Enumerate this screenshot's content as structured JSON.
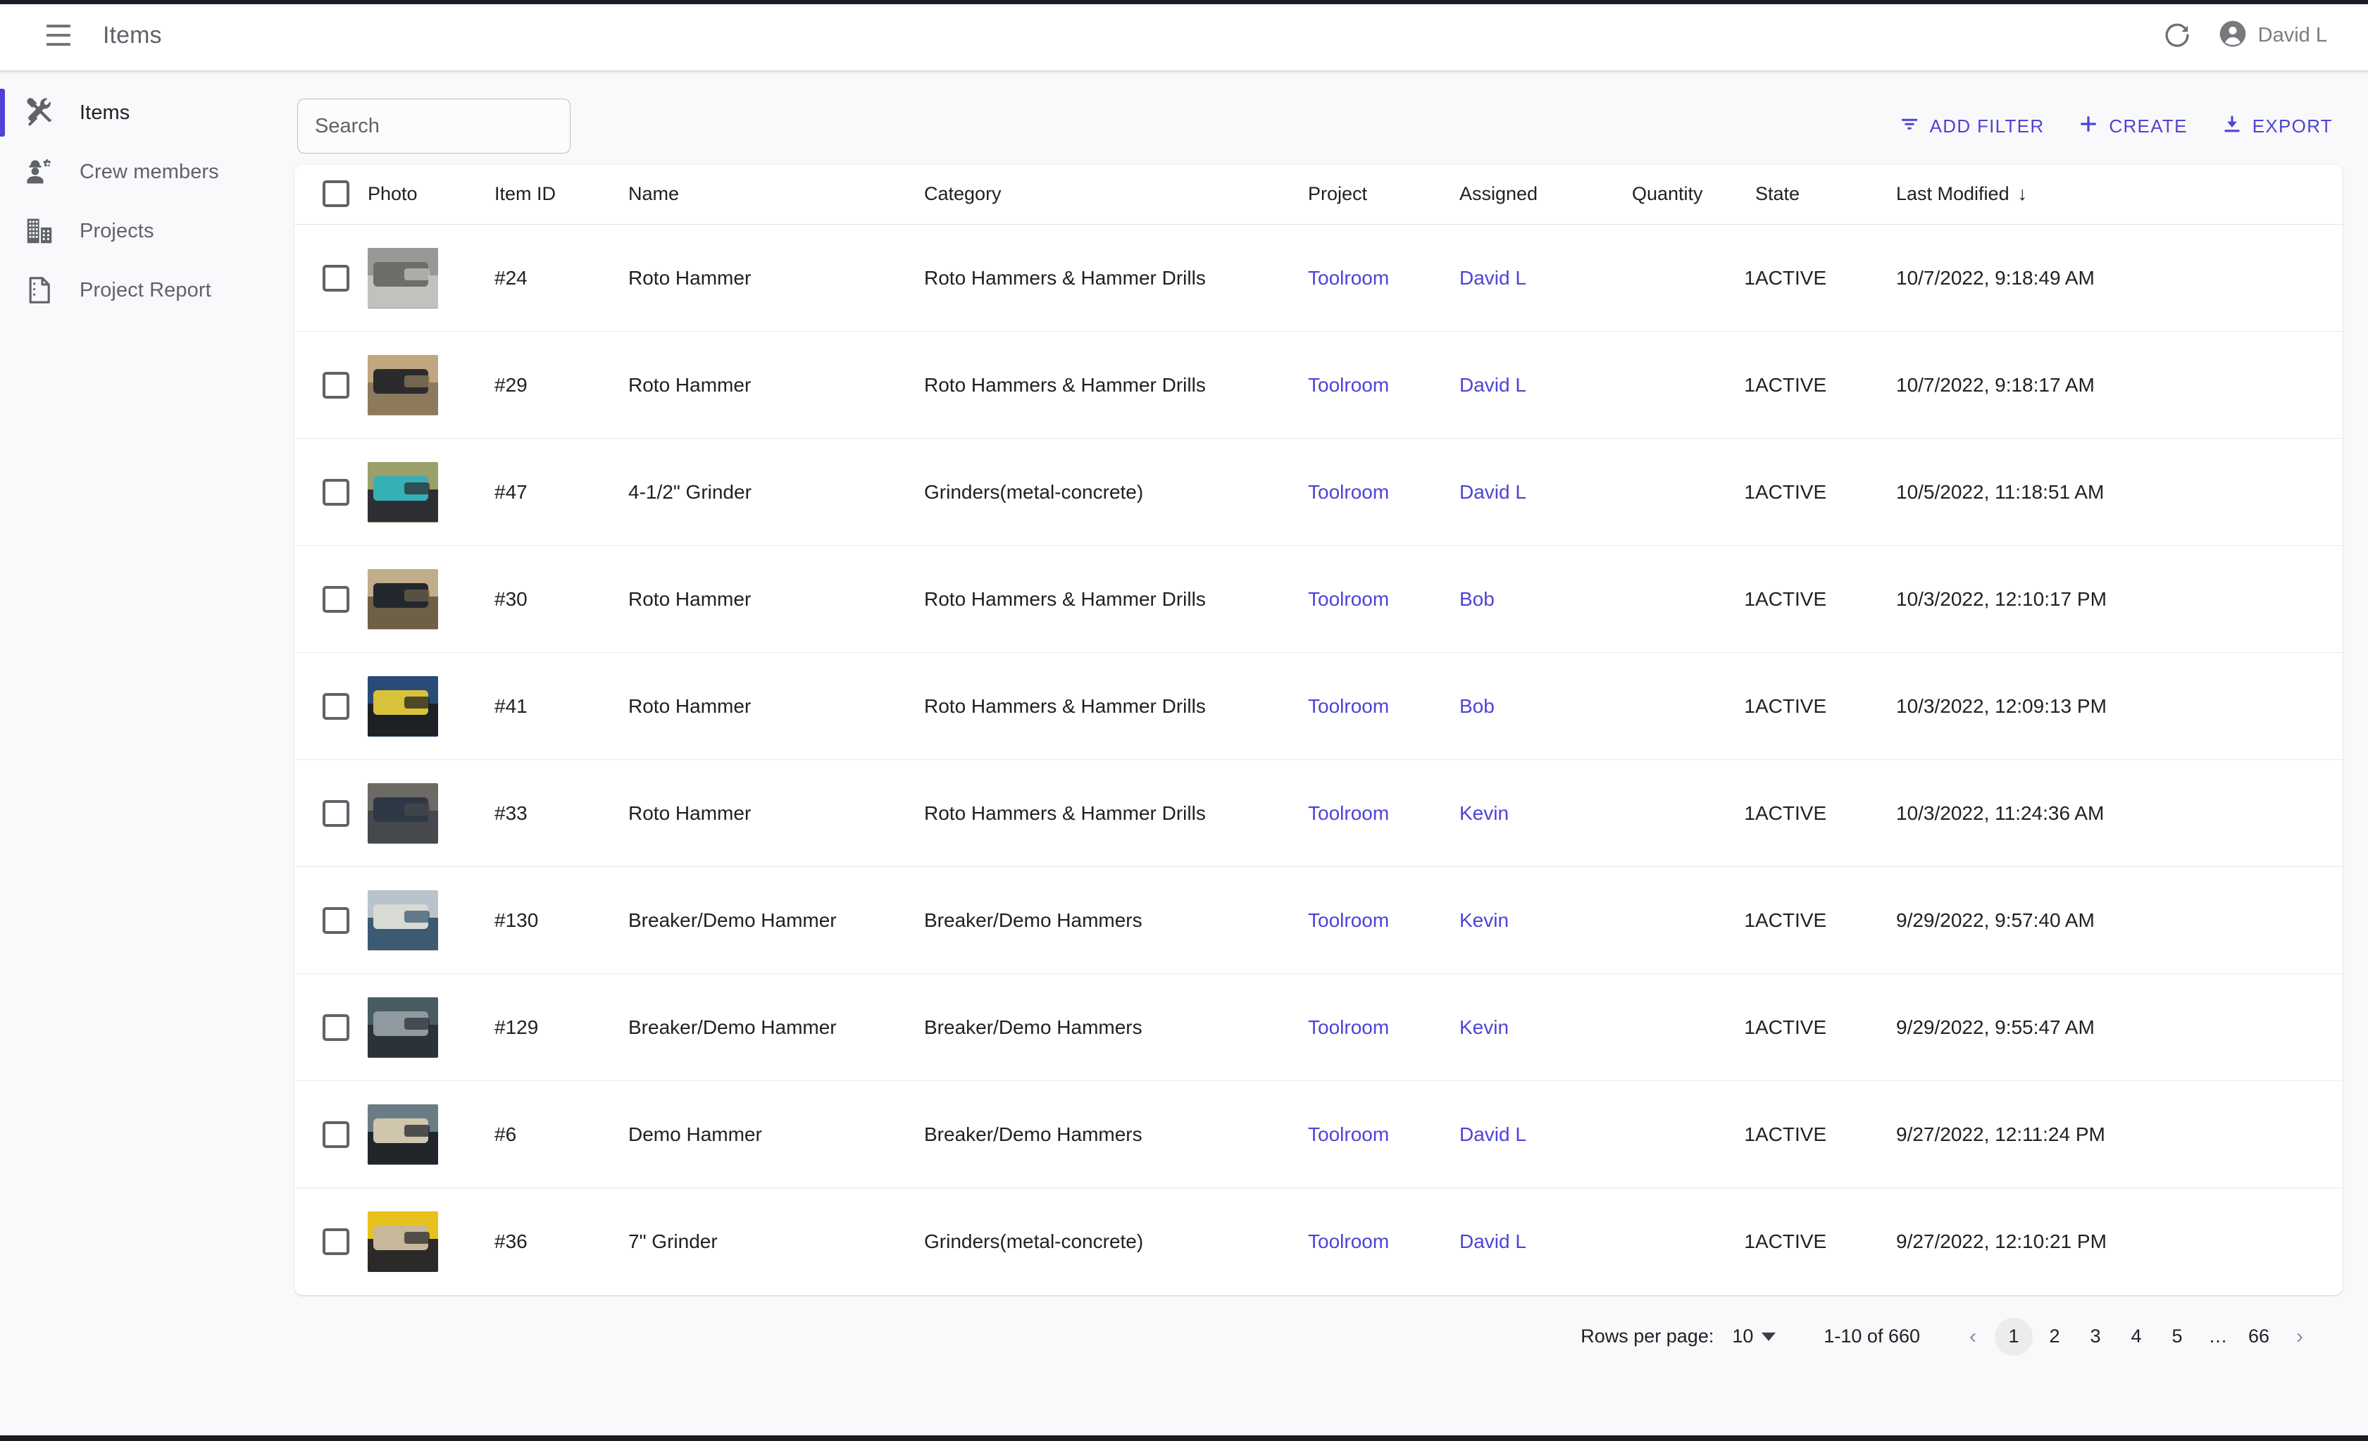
{
  "appbar": {
    "menu_icon": "hamburger-menu-icon",
    "title": "Items",
    "refresh_icon": "refresh-icon",
    "account_icon": "account-circle-icon",
    "user_name": "David L"
  },
  "sidebar": {
    "items": [
      {
        "icon": "tools-icon",
        "label": "Items",
        "active": true
      },
      {
        "icon": "crew-member-icon",
        "label": "Crew members",
        "active": false
      },
      {
        "icon": "building-icon",
        "label": "Projects",
        "active": false
      },
      {
        "icon": "document-icon",
        "label": "Project Report",
        "active": false
      }
    ]
  },
  "search": {
    "placeholder": "Search",
    "value": ""
  },
  "toolbar": {
    "add_filter_label": "ADD FILTER",
    "add_filter_icon": "filter-icon",
    "create_label": "CREATE",
    "create_icon": "plus-icon",
    "export_label": "EXPORT",
    "export_icon": "download-icon",
    "accent_color": "#4e43d6"
  },
  "table": {
    "columns": [
      {
        "key": "check",
        "label": ""
      },
      {
        "key": "photo",
        "label": "Photo"
      },
      {
        "key": "item_id",
        "label": "Item ID"
      },
      {
        "key": "name",
        "label": "Name"
      },
      {
        "key": "category",
        "label": "Category"
      },
      {
        "key": "project",
        "label": "Project"
      },
      {
        "key": "assigned",
        "label": "Assigned"
      },
      {
        "key": "quantity",
        "label": "Quantity"
      },
      {
        "key": "state",
        "label": "State"
      },
      {
        "key": "modified",
        "label": "Last Modified"
      }
    ],
    "sort_column": "Last Modified",
    "sort_direction": "desc",
    "sort_arrow_glyph": "↓",
    "rows": [
      {
        "item_id": "#24",
        "name": "Roto Hammer",
        "category": "Roto Hammers & Hammer Drills",
        "project": "Toolroom",
        "assigned": "David L",
        "quantity": "1",
        "state": "ACTIVE",
        "modified": "10/7/2022, 9:18:49 AM",
        "photo_colors": [
          "#9a9894",
          "#6f6d6a",
          "#c3c1bd"
        ]
      },
      {
        "item_id": "#29",
        "name": "Roto Hammer",
        "category": "Roto Hammers & Hammer Drills",
        "project": "Toolroom",
        "assigned": "David L",
        "quantity": "1",
        "state": "ACTIVE",
        "modified": "10/7/2022, 9:18:17 AM",
        "photo_colors": [
          "#c0a780",
          "#2b2b2f",
          "#8d7a5d"
        ]
      },
      {
        "item_id": "#47",
        "name": "4-1/2\" Grinder",
        "category": "Grinders(metal-concrete)",
        "project": "Toolroom",
        "assigned": "David L",
        "quantity": "1",
        "state": "ACTIVE",
        "modified": "10/5/2022, 11:18:51 AM",
        "photo_colors": [
          "#9aa06a",
          "#36b0b7",
          "#2d2f33"
        ]
      },
      {
        "item_id": "#30",
        "name": "Roto Hammer",
        "category": "Roto Hammers & Hammer Drills",
        "project": "Toolroom",
        "assigned": "Bob",
        "quantity": "1",
        "state": "ACTIVE",
        "modified": "10/3/2022, 12:10:17 PM",
        "photo_colors": [
          "#c2ad8a",
          "#23272e",
          "#6d5f48"
        ]
      },
      {
        "item_id": "#41",
        "name": "Roto Hammer",
        "category": "Roto Hammers & Hammer Drills",
        "project": "Toolroom",
        "assigned": "Bob",
        "quantity": "1",
        "state": "ACTIVE",
        "modified": "10/3/2022, 12:09:13 PM",
        "photo_colors": [
          "#2a4b77",
          "#d8c23a",
          "#1d2024"
        ]
      },
      {
        "item_id": "#33",
        "name": "Roto Hammer",
        "category": "Roto Hammers & Hammer Drills",
        "project": "Toolroom",
        "assigned": "Kevin",
        "quantity": "1",
        "state": "ACTIVE",
        "modified": "10/3/2022, 11:24:36 AM",
        "photo_colors": [
          "#6d6a66",
          "#2f3846",
          "#45484c"
        ]
      },
      {
        "item_id": "#130",
        "name": "Breaker/Demo Hammer",
        "category": "Breaker/Demo Hammers",
        "project": "Toolroom",
        "assigned": "Kevin",
        "quantity": "1",
        "state": "ACTIVE",
        "modified": "9/29/2022, 9:57:40 AM",
        "photo_colors": [
          "#b8c4cc",
          "#d8dad4",
          "#3c5a72"
        ]
      },
      {
        "item_id": "#129",
        "name": "Breaker/Demo Hammer",
        "category": "Breaker/Demo Hammers",
        "project": "Toolroom",
        "assigned": "Kevin",
        "quantity": "1",
        "state": "ACTIVE",
        "modified": "9/29/2022, 9:55:47 AM",
        "photo_colors": [
          "#4a5c63",
          "#8f9aa0",
          "#2b3238"
        ]
      },
      {
        "item_id": "#6",
        "name": "Demo Hammer",
        "category": "Breaker/Demo Hammers",
        "project": "Toolroom",
        "assigned": "David L",
        "quantity": "1",
        "state": "ACTIVE",
        "modified": "9/27/2022, 12:11:24 PM",
        "photo_colors": [
          "#6a7d86",
          "#cfc6ad",
          "#22262b"
        ]
      },
      {
        "item_id": "#36",
        "name": "7\" Grinder",
        "category": "Grinders(metal-concrete)",
        "project": "Toolroom",
        "assigned": "David L",
        "quantity": "1",
        "state": "ACTIVE",
        "modified": "9/27/2022, 12:10:21 PM",
        "photo_colors": [
          "#e8c21c",
          "#c9b79a",
          "#2b2a28"
        ]
      }
    ]
  },
  "pagination": {
    "rows_per_page_label": "Rows per page:",
    "rows_per_page_value": "10",
    "range_label": "1-10 of 660",
    "prev_glyph": "‹",
    "next_glyph": "›",
    "pages": [
      "1",
      "2",
      "3",
      "4",
      "5",
      "…",
      "66"
    ],
    "current_page": "1"
  }
}
